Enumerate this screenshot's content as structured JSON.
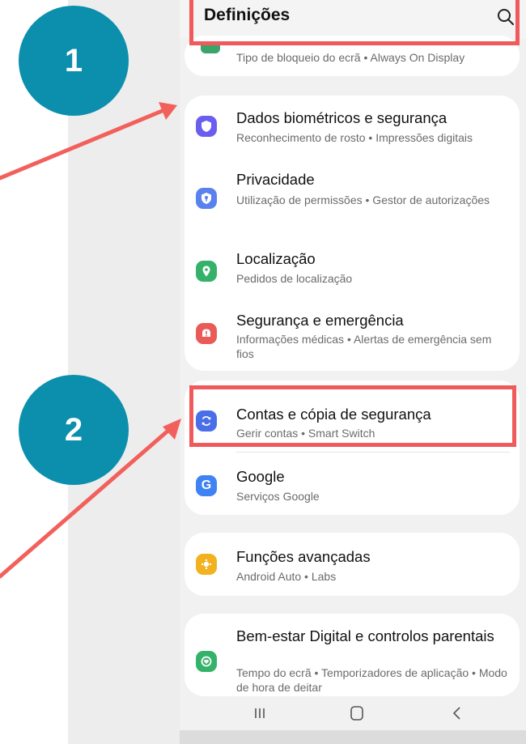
{
  "appbar": {
    "title": "Definições",
    "search_icon": "search-icon"
  },
  "lock_row": {
    "sub": "Tipo de bloqueio do ecrã  •  Always On Display"
  },
  "security_card": {
    "items": [
      {
        "title": "Dados biométricos e segurança",
        "sub": "Reconhecimento de rosto  •  Impressões digitais",
        "icon": "shield-icon",
        "color": "#6a5df0"
      },
      {
        "title": "Privacidade",
        "sub": "Utilização de permissões  •  Gestor de autorizações",
        "icon": "privacy-icon",
        "color": "#5a82ee"
      },
      {
        "title": "Localização",
        "sub": "Pedidos de localização",
        "icon": "location-pin-icon",
        "color": "#35b26a"
      },
      {
        "title": "Segurança e emergência",
        "sub": "Informações médicas  •  Alertas de emergência sem fios",
        "icon": "emergency-icon",
        "color": "#ea5b57"
      }
    ]
  },
  "accounts_card": {
    "items": [
      {
        "title": "Contas e cópia de segurança",
        "sub": "Gerir contas  •  Smart Switch",
        "icon": "sync-icon",
        "color": "#4a6ee8"
      },
      {
        "title": "Google",
        "sub": "Serviços Google",
        "icon": "google-icon",
        "color": "#3f82f3",
        "glyph": "G"
      }
    ]
  },
  "advanced_card": {
    "items": [
      {
        "title": "Funções avançadas",
        "sub": "Android Auto  •  Labs",
        "icon": "puzzle-icon",
        "color": "#f2b21f"
      }
    ]
  },
  "wellbeing_card": {
    "items": [
      {
        "title": "Bem-estar Digital e controlos parentais",
        "sub": "Tempo do ecrã  •  Temporizadores de aplicação  •  Modo de hora de deitar",
        "icon": "wellbeing-icon",
        "color": "#35b26a"
      }
    ]
  },
  "navbar": {
    "recents": "recents-icon",
    "home": "home-icon",
    "back": "back-icon"
  },
  "callouts": {
    "first": "1",
    "second": "2"
  },
  "colors": {
    "highlight": "#f05a5a",
    "callout": "#0b8fac"
  }
}
